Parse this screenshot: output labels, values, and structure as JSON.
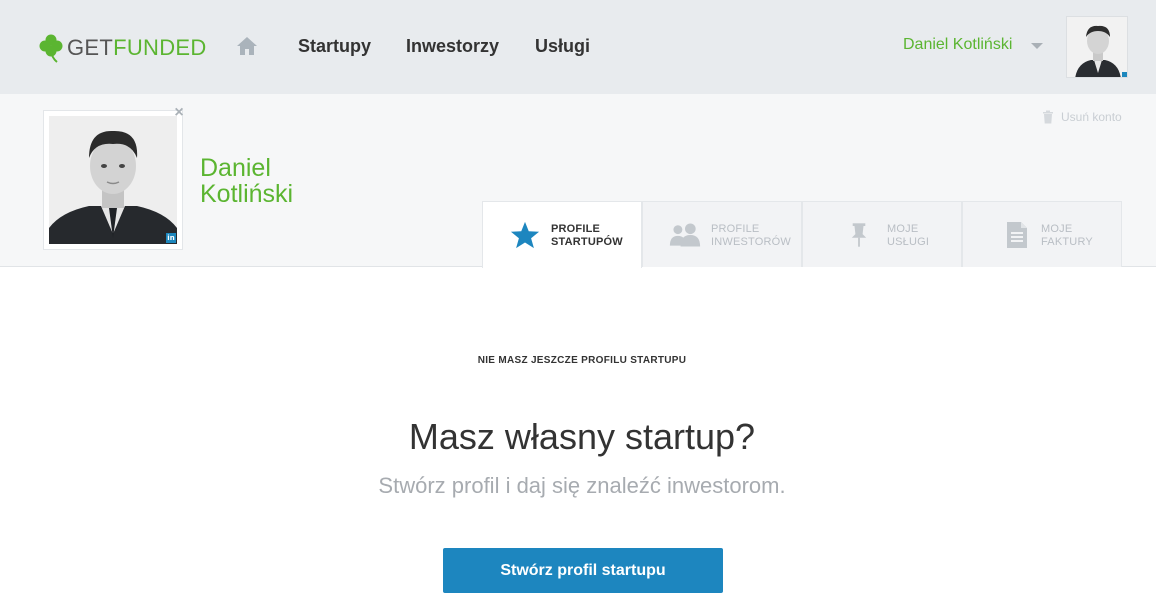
{
  "header": {
    "logo": {
      "part1": "GET",
      "part2": "FUNDED"
    },
    "nav": [
      {
        "label": "Startupy"
      },
      {
        "label": "Inwestorzy"
      },
      {
        "label": "Usługi"
      }
    ],
    "user_name": "Daniel Kotliński"
  },
  "profile": {
    "first_name": "Daniel",
    "last_name": "Kotliński",
    "delete_account_label": "Usuń konto",
    "remove_photo_symbol": "×",
    "linkedin_badge": "in"
  },
  "tabs": [
    {
      "line1": "PROFILE",
      "line2": "STARTUPÓW",
      "icon": "star-icon",
      "active": true
    },
    {
      "line1": "PROFILE",
      "line2": "INWESTORÓW",
      "icon": "users-icon",
      "active": false
    },
    {
      "line1": "MOJE",
      "line2": "USŁUGI",
      "icon": "pin-icon",
      "active": false
    },
    {
      "line1": "MOJE",
      "line2": "FAKTURY",
      "icon": "document-icon",
      "active": false
    }
  ],
  "main": {
    "empty_note": "NIE MASZ JESZCZE PROFILU STARTUPU",
    "headline": "Masz własny startup?",
    "subline": "Stwórz profil i daj się znaleźć inwestorom.",
    "cta_label": "Stwórz profil startupu"
  },
  "colors": {
    "brand_green": "#5bb531",
    "primary_blue": "#1d86bf",
    "topbar_bg": "#e8ebee",
    "band_bg": "#f6f7f8"
  }
}
